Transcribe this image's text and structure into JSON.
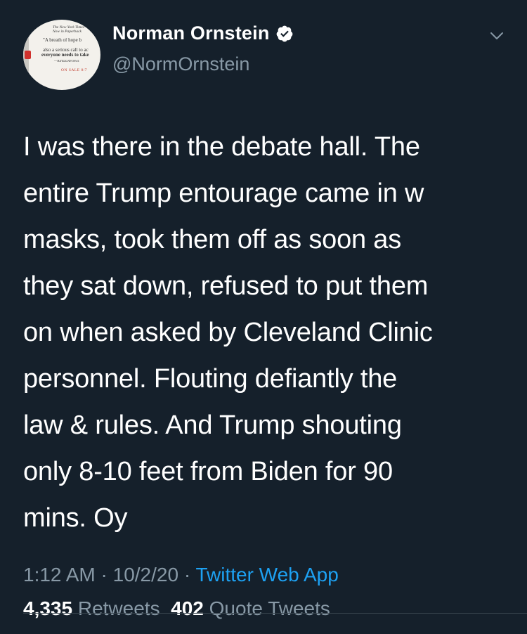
{
  "author": {
    "display_name": "Norman Ornstein",
    "handle": "@NormOrnstein",
    "verified": true,
    "avatar": {
      "line1": "The New York Times",
      "line2": "Now in Paperback",
      "line3": "\"A breath of hope b",
      "line4": "also a serious call to ac",
      "line5": "everyone needs to take",
      "line6": "—Kirkus Reviews",
      "line7": "ON SALE 8/7"
    }
  },
  "tweet": {
    "text": "I was there in the debate hall. The\nentire Trump entourage came in w\nmasks, took them off as soon as\nthey sat down, refused to put them\non when asked by Cleveland Clinic\npersonnel. Flouting defiantly the\nlaw & rules. And Trump shouting\nonly 8-10 feet from Biden for 90\nmins. Oy"
  },
  "meta": {
    "time": "1:12 AM",
    "separator": " · ",
    "date": "10/2/20",
    "source": "Twitter Web App"
  },
  "stats": {
    "retweets_count": "4,335",
    "retweets_label": "Retweets",
    "quotes_count": "402",
    "quotes_label": "Quote Tweets"
  },
  "colors": {
    "background": "#15202b",
    "primary_text": "#ffffff",
    "secondary_text": "#8899a6",
    "accent": "#1da1f2"
  }
}
